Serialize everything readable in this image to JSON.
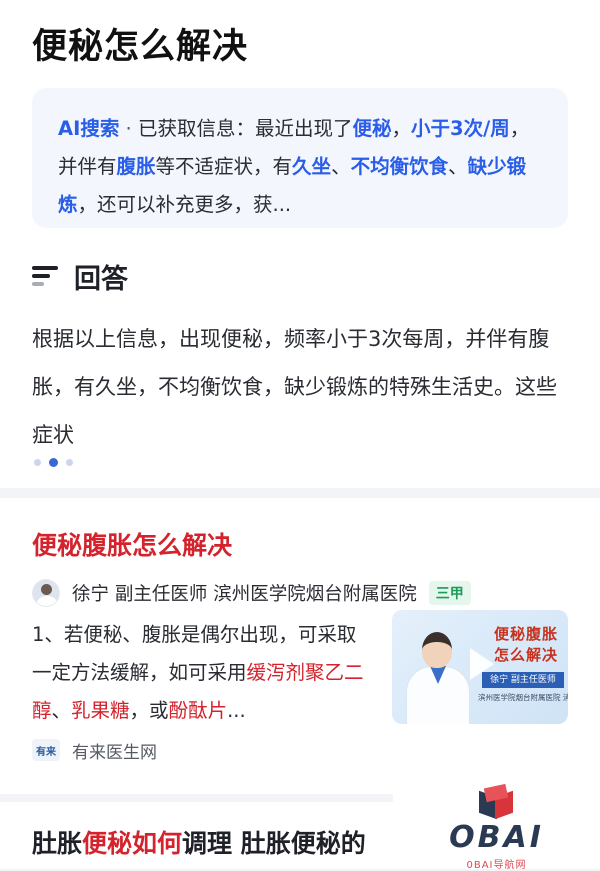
{
  "page_title": "便秘怎么解决",
  "ai_summary": {
    "tag": "AI搜索",
    "sep": " · ",
    "t1": "已获取信息：最近出现了",
    "h1": "便秘",
    "t2": "，",
    "h2": "小于3次/周",
    "t3": "，并伴有",
    "h3": "腹胀",
    "t4": "等不适症状，有",
    "h4": "久坐",
    "t5": "、",
    "h5": "不均衡饮食",
    "t6": "、",
    "h6": "缺少锻炼",
    "t7": "，还可以补充更多，获..."
  },
  "answer": {
    "title": "回答",
    "body": "根据以上信息，出现便秘，频率小于3次每周，并伴有腹胀，有久坐，不均衡饮食，缺少锻炼的特殊生活史。这些症状"
  },
  "result1": {
    "title": "便秘腹胀怎么解决",
    "author": "徐宁 副主任医师 滨州医学院烟台附属医院",
    "badge": "三甲",
    "t1": "1、若便秘、腹胀是偶尔出现，可采取一定方法缓解，如可采用",
    "r1": "缓泻剂聚乙二醇",
    "t2": "、",
    "r2": "乳果糖",
    "t3": "，或",
    "r3": "酚酞片",
    "t4": "...",
    "thumb_title": "便秘腹胀怎么解决",
    "thumb_name": "徐宁  副主任医师",
    "thumb_org": "滨州医学院烟台附属医院  消化",
    "source_logo": "有来",
    "source_name": "有来医生网"
  },
  "result2": {
    "t1": "肚胀",
    "r1": "便秘如何",
    "t2": "调理 肚胀便秘的"
  },
  "watermark": {
    "text": "OBAI",
    "sub": "0BAI导航网"
  }
}
